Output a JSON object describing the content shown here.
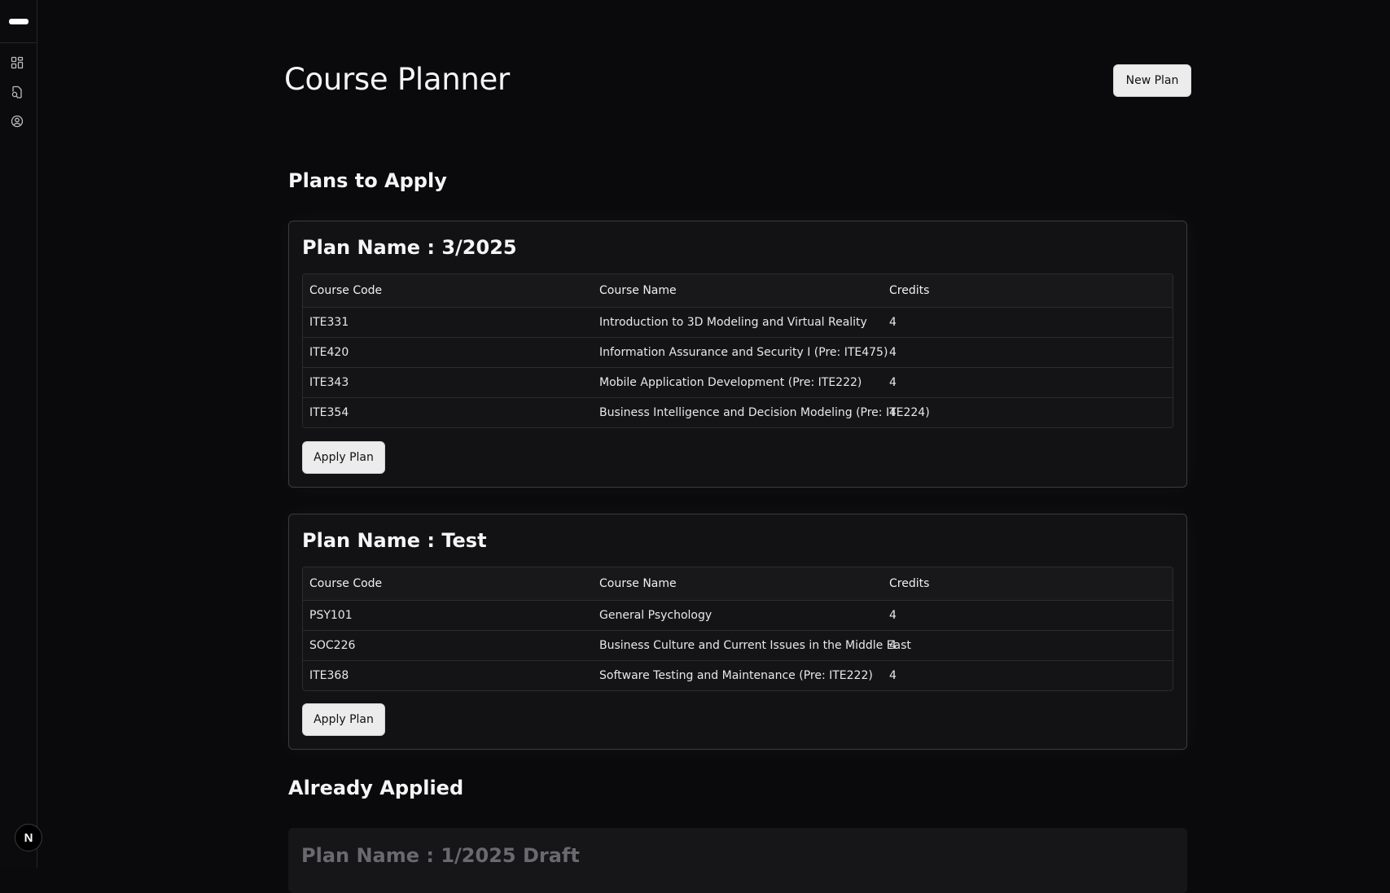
{
  "sidebar": {
    "icons": [
      "dashboard-icon",
      "file-search-icon",
      "user-circle-icon"
    ],
    "badge": "N"
  },
  "header": {
    "title": "Course Planner",
    "new_plan_label": "New Plan"
  },
  "sections": {
    "to_apply": "Plans to Apply",
    "applied": "Already Applied"
  },
  "columns": [
    "Course Code",
    "Course Name",
    "Credits"
  ],
  "plans": [
    {
      "title": "Plan Name : 3/2025",
      "rows": [
        [
          "ITE331",
          "Introduction to 3D Modeling and Virtual Reality",
          "4"
        ],
        [
          "ITE420",
          "Information Assurance and Security I (Pre: ITE475)",
          "4"
        ],
        [
          "ITE343",
          "Mobile Application Development (Pre: ITE222)",
          "4"
        ],
        [
          "ITE354",
          "Business Intelligence and Decision Modeling (Pre: ITE224)",
          "4"
        ]
      ],
      "apply_label": "Apply Plan"
    },
    {
      "title": "Plan Name : Test",
      "rows": [
        [
          "PSY101",
          "General Psychology",
          "4"
        ],
        [
          "SOC226",
          "Business Culture and Current Issues in the Middle East",
          "4"
        ],
        [
          "ITE368",
          "Software Testing and Maintenance (Pre: ITE222)",
          "4"
        ]
      ],
      "apply_label": "Apply Plan"
    }
  ],
  "applied_plans": [
    {
      "title": "Plan Name : 1/2025 Draft"
    }
  ]
}
